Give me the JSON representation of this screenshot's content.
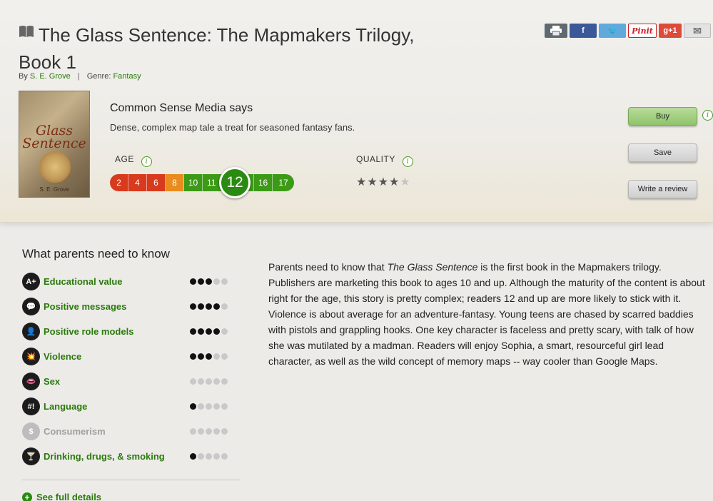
{
  "header": {
    "title": "The Glass Sentence: The Mapmakers Trilogy, Book 1",
    "by_prefix": "By",
    "author": "S. E. Grove",
    "separator": "|",
    "genre_prefix": "Genre:",
    "genre": "Fantasy"
  },
  "share": {
    "print": "",
    "facebook": "f",
    "twitter": "🐦",
    "pinterest": "Pinit",
    "google": "g+1",
    "email": "✉"
  },
  "cover": {
    "title": "Glass Sentence",
    "author": "S. E. Grove"
  },
  "review": {
    "says_label": "Common Sense Media says",
    "tagline": "Dense, complex map tale a treat for seasoned fantasy fans.",
    "age_label": "AGE",
    "quality_label": "QUALITY",
    "info_icon": "i",
    "age_scale": [
      {
        "age": "2",
        "color": "#d83a1e"
      },
      {
        "age": "4",
        "color": "#d83a1e"
      },
      {
        "age": "6",
        "color": "#d83a1e"
      },
      {
        "age": "8",
        "color": "#e98b1e"
      },
      {
        "age": "10",
        "color": "#3c9a17"
      },
      {
        "age": "11",
        "color": "#3c9a17"
      },
      {
        "age": "14",
        "color": "#3c9a17"
      },
      {
        "age": "16",
        "color": "#3c9a17"
      },
      {
        "age": "17",
        "color": "#3c9a17"
      }
    ],
    "selected_age": "12",
    "quality_stars": 4,
    "quality_max": 5
  },
  "actions": {
    "buy": "Buy",
    "save": "Save",
    "write_review": "Write a review"
  },
  "parents": {
    "heading": "What parents need to know",
    "categories": [
      {
        "icon": "A+",
        "icon_name": "educational-value-icon",
        "label": "Educational value",
        "rating": 3,
        "muted": false
      },
      {
        "icon": "💬",
        "icon_name": "positive-messages-icon",
        "label": "Positive messages",
        "rating": 4,
        "muted": false
      },
      {
        "icon": "👤",
        "icon_name": "positive-role-models-icon",
        "label": "Positive role models",
        "rating": 4,
        "muted": false
      },
      {
        "icon": "💥",
        "icon_name": "violence-icon",
        "label": "Violence",
        "rating": 3,
        "muted": false
      },
      {
        "icon": "👄",
        "icon_name": "sex-icon",
        "label": "Sex",
        "rating": 0,
        "muted": false
      },
      {
        "icon": "#!",
        "icon_name": "language-icon",
        "label": "Language",
        "rating": 1,
        "muted": false
      },
      {
        "icon": "$",
        "icon_name": "consumerism-icon",
        "label": "Consumerism",
        "rating": 0,
        "muted": true
      },
      {
        "icon": "🍸",
        "icon_name": "drinking-icon",
        "label": "Drinking, drugs, & smoking",
        "rating": 1,
        "muted": false
      }
    ],
    "see_full": "See full details",
    "text_before": "Parents need to know that ",
    "text_italic": "The Glass Sentence",
    "text_after": " is the first book in the Mapmakers trilogy. Publishers are marketing this book to ages 10 and up. Although the maturity of the content is about right for the age, this story is pretty complex; readers 12 and up are more likely to stick with it. Violence is about average for an adventure-fantasy. Young teens are chased by scarred baddies with pistols and grappling hooks. One key character is faceless and pretty scary, with talk of how she was mutilated by a madman. Readers will enjoy Sophia, a smart, resourceful girl lead character, as well as the wild concept of memory maps -- way cooler than Google Maps."
  }
}
